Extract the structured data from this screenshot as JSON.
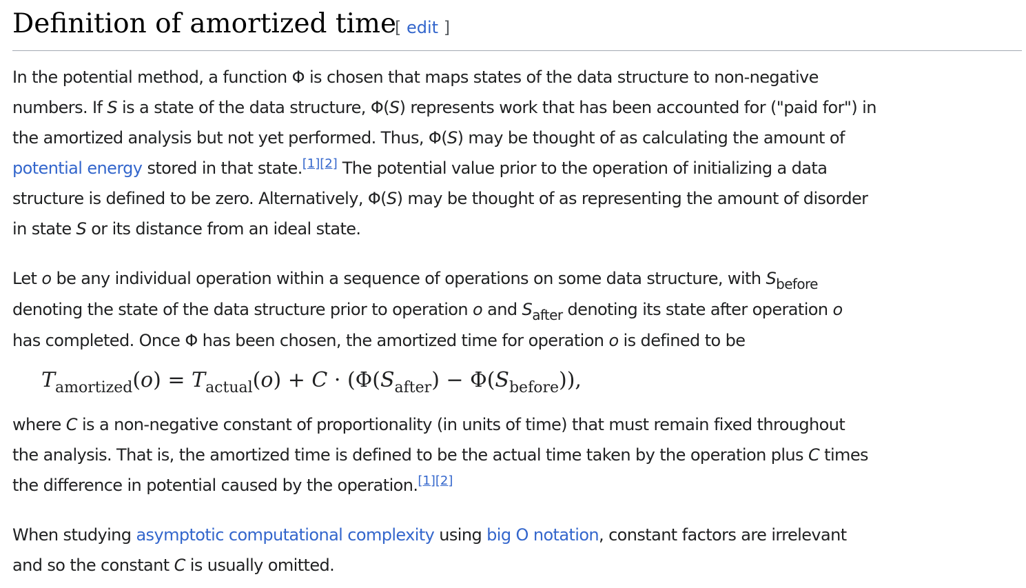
{
  "heading": {
    "title": "Definition of amortized time",
    "edit_open": "[",
    "edit_label": "edit",
    "edit_close": "]"
  },
  "para1": {
    "t1": "In the potential method, a function Φ is chosen that maps states of the data structure to non-negative",
    "t2a": "numbers. If ",
    "s": "S",
    "t2b": " is a state of the data structure, Φ(",
    "t2c": ") represents work that has been accounted for (\"paid for\") in",
    "t3a": "the amortized analysis but not yet performed. Thus, Φ(",
    "t3b": ") may be thought of as calculating the amount of",
    "link_potential_energy": "potential energy",
    "t4a": " stored in that state.",
    "ref1": "[1]",
    "ref2": "[2]",
    "t4b": " The potential value prior to the operation of initializing a data",
    "t5a": "structure is defined to be zero. Alternatively, Φ(",
    "t5b": ") may be thought of as representing the amount of disorder",
    "t6a": "in state ",
    "t6b": " or its distance from an ideal state."
  },
  "para2": {
    "t1a": "Let ",
    "o": "o",
    "t1b": " be any individual operation within a sequence of operations on some data structure, with ",
    "s": "S",
    "before": "before",
    "after": "after",
    "t2a": "denoting the state of the data structure prior to operation ",
    "t2b": " and ",
    "t2c": " denoting its state after operation ",
    "t3a": "has completed. Once Φ has been chosen, the amortized time for operation ",
    "t3b": " is defined to be"
  },
  "formula": {
    "T": "T",
    "amortized": "amortized",
    "actual": "actual",
    "o": "o",
    "S": "S",
    "after": "after",
    "before": "before",
    "lp": "(",
    "rp": ")",
    "eq": " = ",
    "plus": " + ",
    "C": "C",
    "dot": " · (Φ(",
    "minus": ") − Φ(",
    "end": ")),"
  },
  "para3": {
    "t1a": "where ",
    "c": "C",
    "t1b": " is a non-negative constant of proportionality (in units of time) that must remain fixed throughout",
    "t2a": "the analysis. That is, the amortized time is defined to be the actual time taken by the operation plus ",
    "t2b": " times",
    "t3": "the difference in potential caused by the operation.",
    "ref1": "[1]",
    "ref2": "[2]"
  },
  "para4": {
    "t1a": "When studying ",
    "link_asymptotic": "asymptotic computational complexity",
    "t1b": " using ",
    "link_big_o": "big O notation",
    "t1c": ", constant factors are irrelevant",
    "t2a": "and so the constant ",
    "c": "C",
    "t2b": " is usually omitted."
  }
}
